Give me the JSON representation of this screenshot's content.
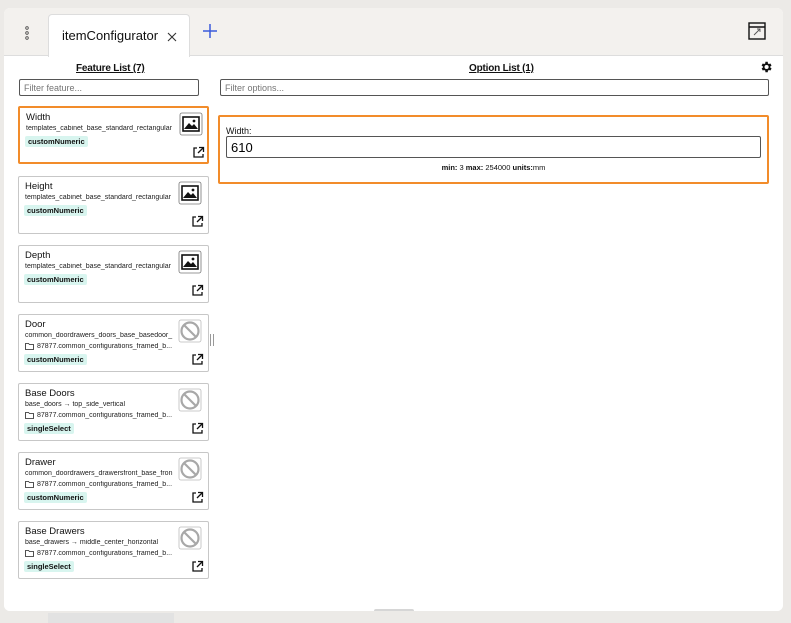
{
  "tabs": [
    {
      "title": "itemConfigurator"
    }
  ],
  "feature_list": {
    "heading": "Feature List (7)",
    "filter_placeholder": "Filter feature...",
    "items": [
      {
        "name": "Width",
        "path": "templates_cabinet_base_standard_rectangular",
        "type": "customNumeric",
        "thumb": "image-icon",
        "selected": true
      },
      {
        "name": "Height",
        "path": "templates_cabinet_base_standard_rectangular",
        "type": "customNumeric",
        "thumb": "image-icon"
      },
      {
        "name": "Depth",
        "path": "templates_cabinet_base_standard_rectangular",
        "type": "customNumeric",
        "thumb": "image-icon"
      },
      {
        "name": "Door",
        "path": "common_doordrawers_doors_base_basedoor_",
        "path2": "87877.common_configurations_framed_b...",
        "type": "customNumeric",
        "thumb": "no-image-icon"
      },
      {
        "name": "Base Doors",
        "path": "base_doors → top_side_vertical",
        "path2": "87877.common_configurations_framed_b...",
        "type": "singleSelect",
        "thumb": "no-image-icon"
      },
      {
        "name": "Drawer",
        "path": "common_doordrawers_drawersfront_base_fron",
        "path2": "87877.common_configurations_framed_b...",
        "type": "customNumeric",
        "thumb": "no-image-icon"
      },
      {
        "name": "Base Drawers",
        "path": "base_drawers → middle_center_horizontal",
        "path2": "87877.common_configurations_framed_b...",
        "type": "singleSelect",
        "thumb": "no-image-icon"
      }
    ]
  },
  "option_list": {
    "heading": "Option List (1)",
    "filter_placeholder": "Filter options...",
    "option": {
      "label": "Width:",
      "value": "610",
      "min_label": "min:",
      "min": "3",
      "max_label": "max:",
      "max": "254000",
      "units_label": "units:",
      "units": "mm"
    }
  },
  "colors": {
    "accent": "#f28c2a",
    "badge_bg": "#d8f5ef",
    "add_tab": "#3b5bdb"
  }
}
